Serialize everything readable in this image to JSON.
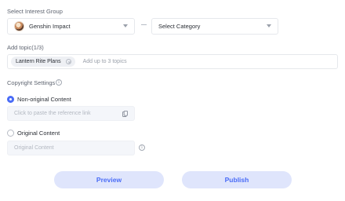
{
  "group": {
    "label": "Select Interest Group",
    "game_select": {
      "value": "Genshin Impact",
      "icon": "game-avatar"
    },
    "category_select": {
      "value": "Select Category"
    }
  },
  "topic": {
    "label": "Add topic(1/3)",
    "chips": [
      {
        "text": "Lantern Rite Plans"
      }
    ],
    "placeholder": "Add up to 3 topics"
  },
  "copyright": {
    "label": "Copyright Settings",
    "options": [
      {
        "label": "Non-original Content",
        "selected": true,
        "input_placeholder": "Click to paste the reference link"
      },
      {
        "label": "Original Content",
        "selected": false,
        "input_placeholder": "Original Content"
      }
    ]
  },
  "actions": {
    "preview": "Preview",
    "publish": "Publish"
  },
  "colors": {
    "accent": "#4a6cf7",
    "button_bg": "#dfe5fc"
  }
}
